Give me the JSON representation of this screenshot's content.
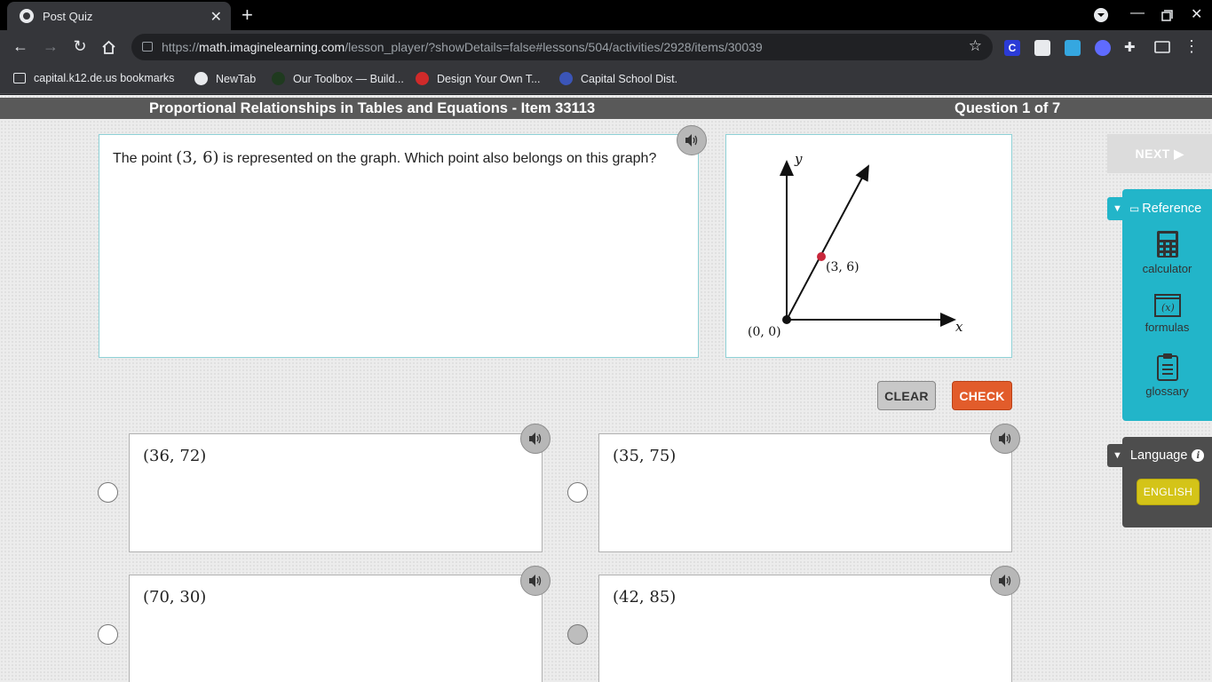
{
  "browser": {
    "tab_title": "Post Quiz",
    "url_prefix": "https://",
    "url_host": "math.imaginelearning.com",
    "url_path": "/lesson_player/?showDetails=false#lessons/504/activities/2928/items/30039",
    "bookmarks": [
      {
        "label": "capital.k12.de.us bookmarks"
      },
      {
        "label": "NewTab"
      },
      {
        "label": "Our Toolbox — Build..."
      },
      {
        "label": "Design Your Own T..."
      },
      {
        "label": "Capital School Dist."
      }
    ]
  },
  "header": {
    "title": "Proportional Relationships in Tables and Equations - Item 33113",
    "progress": "Question 1 of 7"
  },
  "question": {
    "text_before": "The point",
    "point": "(3, 6)",
    "text_after": "is represented on the graph. Which point also belongs on this graph?"
  },
  "graph": {
    "axis_x": "x",
    "axis_y": "y",
    "origin_label": "(0, 0)",
    "point_label": "(3, 6)",
    "point_color": "#c8273b"
  },
  "actions": {
    "clear": "CLEAR",
    "check": "CHECK",
    "next": "NEXT ▶"
  },
  "choices": [
    {
      "value": "(36, 72)",
      "selected": false
    },
    {
      "value": "(35, 75)",
      "selected": false
    },
    {
      "value": "(70, 30)",
      "selected": false
    },
    {
      "value": "(42, 85)",
      "selected": false
    }
  ],
  "reference": {
    "title": "Reference",
    "tools": [
      {
        "label": "calculator",
        "icon": "calculator-icon"
      },
      {
        "label": "formulas",
        "icon": "formulas-icon"
      },
      {
        "label": "glossary",
        "icon": "glossary-icon"
      }
    ]
  },
  "language": {
    "title": "Language",
    "button": "ENGLISH"
  },
  "colors": {
    "accent_teal": "#22b5c9",
    "check_orange": "#e25c2b",
    "language_yellow": "#d4c418"
  }
}
